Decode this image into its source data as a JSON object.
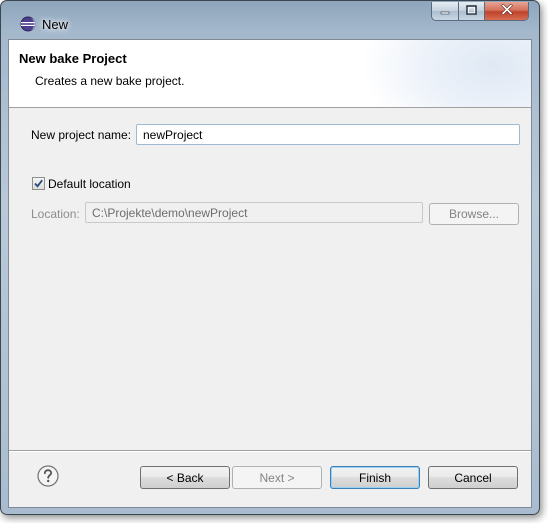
{
  "window": {
    "title": "New",
    "controls": {
      "minimize_icon": "minimize-icon",
      "maximize_icon": "maximize-icon",
      "close_icon": "close-icon"
    }
  },
  "header": {
    "title": "New bake Project",
    "description": "Creates a new bake project."
  },
  "form": {
    "project_name_label": "New project name:",
    "project_name_value": "newProject",
    "default_location_label": "Default location",
    "default_location_checked": true,
    "location_label": "Location:",
    "location_value": "C:\\Projekte\\demo\\newProject",
    "browse_label": "Browse..."
  },
  "footer": {
    "help_icon": "help-icon",
    "back_label": "< Back",
    "next_label": "Next >",
    "finish_label": "Finish",
    "cancel_label": "Cancel"
  },
  "colors": {
    "accent": "#3c7fb1",
    "window_frame": "#a4b8cc",
    "dialog_background": "#f0f0f0",
    "close_button": "#c0432b"
  }
}
